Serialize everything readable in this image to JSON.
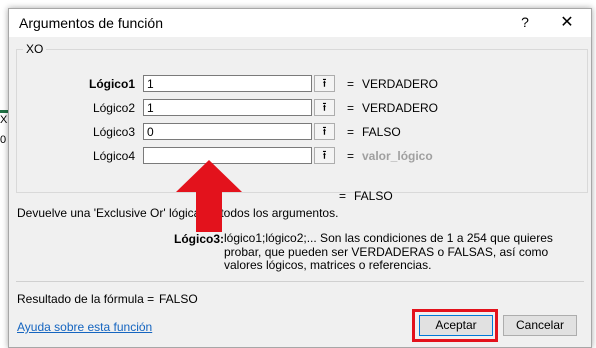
{
  "dialog": {
    "title": "Argumentos de función",
    "help_button": "?",
    "close_button": "✕"
  },
  "function": {
    "name": "XO",
    "args": [
      {
        "label": "Lógico1",
        "value": "1",
        "result": "VERDADERO",
        "bold": true
      },
      {
        "label": "Lógico2",
        "value": "1",
        "result": "VERDADERO",
        "bold": false
      },
      {
        "label": "Lógico3",
        "value": "0",
        "result": "FALSO",
        "bold": false
      },
      {
        "label": "Lógico4",
        "value": "",
        "result": "valor_lógico",
        "bold": false
      }
    ],
    "ref_icon": "collapse-dialog-icon",
    "equals": "=",
    "formula_result_inline": "FALSO",
    "description": "Devuelve una 'Exclusive Or' lógica de todos los argumentos.",
    "arg_desc_label": "Lógico3:",
    "arg_desc_text": "lógico1;lógico2;... Son las condiciones de 1 a 254 que quieres probar, que pueden ser VERDADERAS o FALSAS, así como valores lógicos, matrices o referencias."
  },
  "footer": {
    "formula_result_label": "Resultado de la fórmula =",
    "formula_result_value": "FALSO",
    "help_link": "Ayuda sobre esta función",
    "ok_label": "Aceptar",
    "cancel_label": "Cancelar"
  },
  "background": {
    "cell_1": "X",
    "cell_2": "0"
  },
  "colors": {
    "highlight": "#e3121c",
    "link": "#1565c0"
  }
}
